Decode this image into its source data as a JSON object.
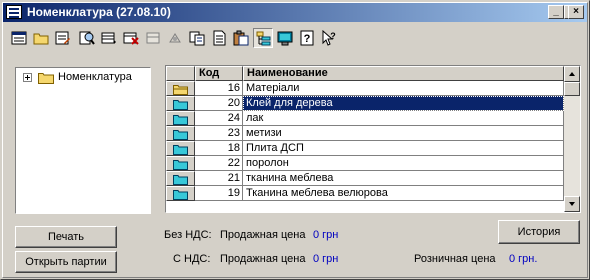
{
  "window": {
    "title": "Номенклатура (27.08.10)",
    "controls": {
      "minimize": "_",
      "maximize": "□",
      "close": "×"
    }
  },
  "toolbar": {
    "items": [
      {
        "name": "new-list-icon"
      },
      {
        "name": "folder-icon"
      },
      {
        "name": "edit-list-icon"
      },
      {
        "name": "find-icon"
      },
      {
        "name": "add-row-icon"
      },
      {
        "name": "delete-row-icon"
      },
      {
        "name": "copy-disabled-icon"
      },
      {
        "name": "link-disabled-icon"
      },
      {
        "name": "copy-icon"
      },
      {
        "name": "document-icon"
      },
      {
        "name": "paste-icon"
      },
      {
        "name": "tree-view-icon",
        "pressed": true
      },
      {
        "name": "monitor-icon"
      },
      {
        "name": "help-icon"
      },
      {
        "name": "context-help-icon"
      }
    ]
  },
  "tree": {
    "root_label": "Номенклатура"
  },
  "grid": {
    "columns": {
      "code": "Код",
      "name": "Наименование"
    },
    "rows": [
      {
        "code": "16",
        "name": "Матеріали",
        "folder": "open"
      },
      {
        "code": "20",
        "name": "Клей для дерева",
        "folder": "closed",
        "selected": true
      },
      {
        "code": "24",
        "name": "лак",
        "folder": "closed"
      },
      {
        "code": "23",
        "name": "метизи",
        "folder": "closed"
      },
      {
        "code": "18",
        "name": "Плита ДСП",
        "folder": "closed"
      },
      {
        "code": "22",
        "name": "поролон",
        "folder": "closed"
      },
      {
        "code": "21",
        "name": "тканина  меблева",
        "folder": "closed"
      },
      {
        "code": "19",
        "name": "Тканина меблева велюрова",
        "folder": "closed"
      }
    ]
  },
  "buttons": {
    "print": "Печать",
    "open_parties": "Открыть партии",
    "history": "История"
  },
  "prices": {
    "without_vat_label": "Без НДС:",
    "with_vat_label": "С НДС:",
    "sale_price_label": "Продажная цена",
    "without_vat_value": "0 грн",
    "with_vat_value": "0 грн",
    "retail_price_label": "Розничная цена",
    "retail_value": "0 грн."
  },
  "colors": {
    "title_start": "#0a246a",
    "title_end": "#a6caf0",
    "selection": "#0a246a",
    "value_text": "#0000c0",
    "folder": "#f5d76e",
    "folder_cyan": "#38c8d8"
  }
}
